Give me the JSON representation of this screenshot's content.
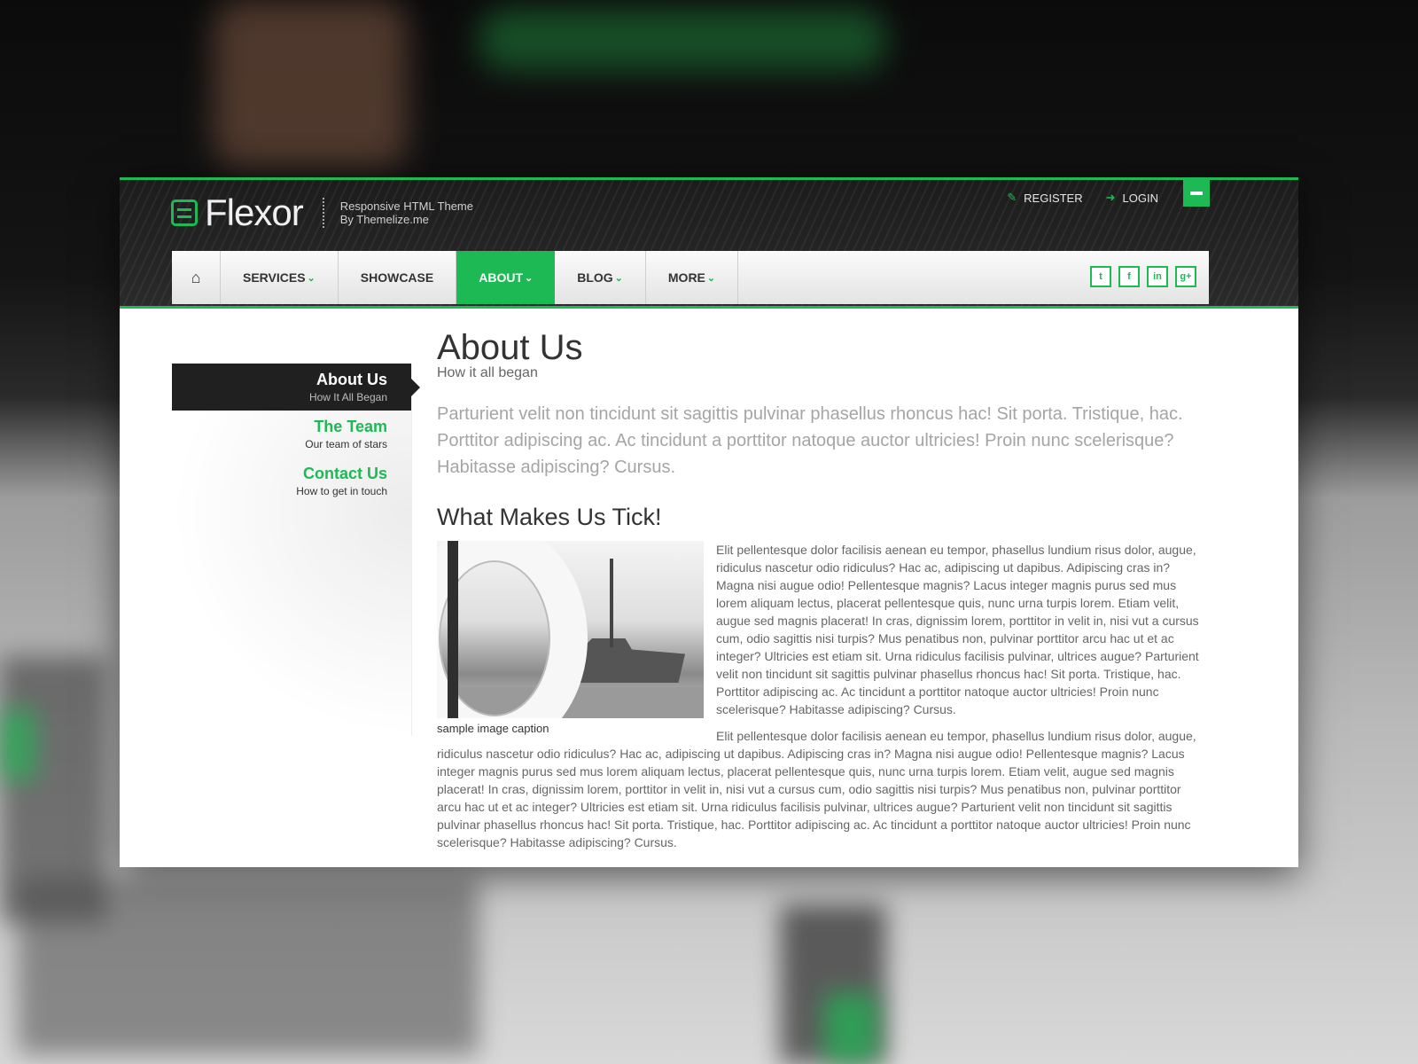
{
  "colors": {
    "accent": "#1db954",
    "header_bg": "#222222",
    "sidebar_active_bg": "#202020"
  },
  "brand": {
    "name": "Flexor",
    "tagline_line1": "Responsive HTML Theme",
    "tagline_line2": "By Themelize.me"
  },
  "top_links": [
    {
      "icon": "edit-icon",
      "label": "REGISTER"
    },
    {
      "icon": "login-icon",
      "label": "LOGIN"
    }
  ],
  "nav": {
    "home_icon": "home-icon",
    "items": [
      {
        "label": "SERVICES",
        "caret": "⌄"
      },
      {
        "label": "SHOWCASE",
        "caret": ""
      },
      {
        "label": "ABOUT",
        "caret": "⌄"
      },
      {
        "label": "BLOG",
        "caret": "⌄"
      },
      {
        "label": "MORE",
        "caret": "⌄"
      }
    ],
    "social": [
      {
        "icon": "twitter-icon",
        "glyph": "t"
      },
      {
        "icon": "facebook-icon",
        "glyph": "f"
      },
      {
        "icon": "linkedin-icon",
        "glyph": "in"
      },
      {
        "icon": "google-plus-icon",
        "glyph": "g+"
      }
    ]
  },
  "sidebar": {
    "items": [
      {
        "title": "About Us",
        "sub": "How It All Began"
      },
      {
        "title": "The Team",
        "sub": "Our team of stars"
      },
      {
        "title": "Contact Us",
        "sub": "How to get in touch"
      }
    ]
  },
  "main": {
    "title": "About Us",
    "subtitle": "How it all began",
    "lead": "Parturient velit non tincidunt sit sagittis pulvinar phasellus rhoncus hac! Sit porta. Tristique, hac. Porttitor adipiscing ac. Ac tincidunt a porttitor natoque auctor ultricies! Proin nunc scelerisque? Habitasse adipiscing? Cursus.",
    "section_title": "What Makes Us Tick!",
    "image_caption": "sample image caption",
    "para1": "Elit pellentesque dolor facilisis aenean eu tempor, phasellus lundium risus dolor, augue, ridiculus nascetur odio ridiculus? Hac ac, adipiscing ut dapibus. Adipiscing cras in? Magna nisi augue odio! Pellentesque magnis? Lacus integer magnis purus sed mus lorem aliquam lectus, placerat pellentesque quis, nunc urna turpis lorem. Etiam velit, augue sed magnis placerat! In cras, dignissim lorem, porttitor in velit in, nisi vut a cursus cum, odio sagittis nisi turpis? Mus penatibus non, pulvinar porttitor arcu hac ut et ac integer? Ultricies est etiam sit. Urna ridiculus facilisis pulvinar, ultrices augue? Parturient velit non tincidunt sit sagittis pulvinar phasellus rhoncus hac! Sit porta. Tristique, hac. Porttitor adipiscing ac. Ac tincidunt a porttitor natoque auctor ultricies! Proin nunc scelerisque? Habitasse adipiscing? Cursus.",
    "para2": "Elit pellentesque dolor facilisis aenean eu tempor, phasellus lundium risus dolor, augue, ridiculus nascetur odio ridiculus? Hac ac, adipiscing ut dapibus. Adipiscing cras in? Magna nisi augue odio! Pellentesque magnis? Lacus integer magnis purus sed mus lorem aliquam lectus, placerat pellentesque quis, nunc urna turpis lorem. Etiam velit, augue sed magnis placerat! In cras, dignissim lorem, porttitor in velit in, nisi vut a cursus cum, odio sagittis nisi turpis? Mus penatibus non, pulvinar porttitor arcu hac ut et ac integer? Ultricies est etiam sit. Urna ridiculus facilisis pulvinar, ultrices augue? Parturient velit non tincidunt sit sagittis pulvinar phasellus rhoncus hac! Sit porta. Tristique, hac. Porttitor adipiscing ac. Ac tincidunt a porttitor natoque auctor ultricies! Proin nunc scelerisque? Habitasse adipiscing? Cursus."
  }
}
